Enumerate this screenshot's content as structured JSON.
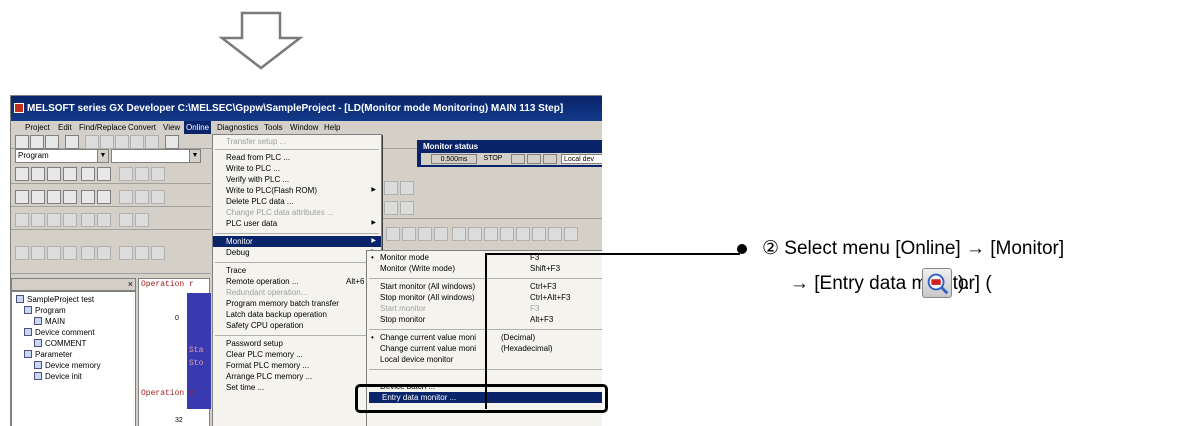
{
  "window": {
    "title": "MELSOFT series GX Developer C:\\MELSEC\\Gppw\\SampleProject - [LD(Monitor mode Monitoring)    MAIN    113 Step]"
  },
  "menubar": [
    "Project",
    "Edit",
    "Find/Replace",
    "Convert",
    "View",
    "Online",
    "Diagnostics",
    "Tools",
    "Window",
    "Help"
  ],
  "toolbar": {
    "program_combo": "Program",
    "close_glyph": "×"
  },
  "monitor_status": {
    "title": "Monitor status",
    "scan_time": "0.500ms",
    "state": "STOP",
    "station": "Local dev"
  },
  "tree": {
    "items": [
      "SampleProject test",
      "Program",
      "MAIN",
      "Device comment",
      "COMMENT",
      "Parameter",
      "Device memory",
      "Device init"
    ]
  },
  "ladder": {
    "text1": "Operation r",
    "text2": "Operation c",
    "step0": "0",
    "step32": "32",
    "frag1": "Sta",
    "frag2": "Sto"
  },
  "online_menu": [
    {
      "label": "Transfer setup ...",
      "disabled": true
    },
    {
      "label": "Read from PLC ..."
    },
    {
      "label": "Write to PLC ..."
    },
    {
      "label": "Verify with PLC ..."
    },
    {
      "label": "Write to PLC(Flash ROM)",
      "submenu": true
    },
    {
      "label": "Delete PLC data ..."
    },
    {
      "label": "Change PLC data attributes ...",
      "disabled": true
    },
    {
      "label": "PLC user data",
      "submenu": true
    },
    {
      "label": "Monitor",
      "submenu": true,
      "highlighted": true
    },
    {
      "label": "Debug",
      "submenu": true
    },
    {
      "label": "Trace",
      "submenu": true
    },
    {
      "label": "Remote operation ...",
      "shortcut": "Alt+6"
    },
    {
      "label": "Redundant operation...",
      "disabled": true
    },
    {
      "label": "Program memory batch transfer"
    },
    {
      "label": "Latch data backup operation",
      "submenu": true
    },
    {
      "label": "Safety CPU operation",
      "submenu": true
    },
    {
      "label": "Password setup",
      "submenu": true
    },
    {
      "label": "Clear PLC memory ..."
    },
    {
      "label": "Format PLC memory ..."
    },
    {
      "label": "Arrange PLC memory ..."
    },
    {
      "label": "Set time ..."
    }
  ],
  "monitor_menu": [
    {
      "label": "Monitor mode",
      "shortcut": "F3",
      "bullet": true
    },
    {
      "label": "Monitor (Write mode)",
      "shortcut": "Shift+F3"
    },
    {
      "label": "Start monitor (All windows)",
      "shortcut": "Ctrl+F3"
    },
    {
      "label": "Stop monitor (All windows)",
      "shortcut": "Ctrl+Alt+F3"
    },
    {
      "label": "Start monitor",
      "shortcut": "F3",
      "disabled": true
    },
    {
      "label": "Stop monitor",
      "shortcut": "Alt+F3"
    },
    {
      "label": "Change current value moni",
      "extra": "(Decimal)",
      "bullet": true
    },
    {
      "label": "Change current value moni",
      "extra": "(Hexadecimal)"
    },
    {
      "label": "Local device monitor"
    },
    {
      "label": "Device batch ..."
    },
    {
      "label": "Entry data monitor ...",
      "highlighted": true
    }
  ],
  "instruction": {
    "line1": "② Select menu [Online] → [Monitor]",
    "line2_prefix": "→ [Entry data monitor] (",
    "line2_suffix": ")."
  },
  "colors": {
    "title_bar": "#0a246a",
    "menu_highlight": "#0a246a",
    "window_face": "#d4d0c8"
  },
  "icons": [
    "down-arrow-icon",
    "entry-data-monitor-icon"
  ]
}
